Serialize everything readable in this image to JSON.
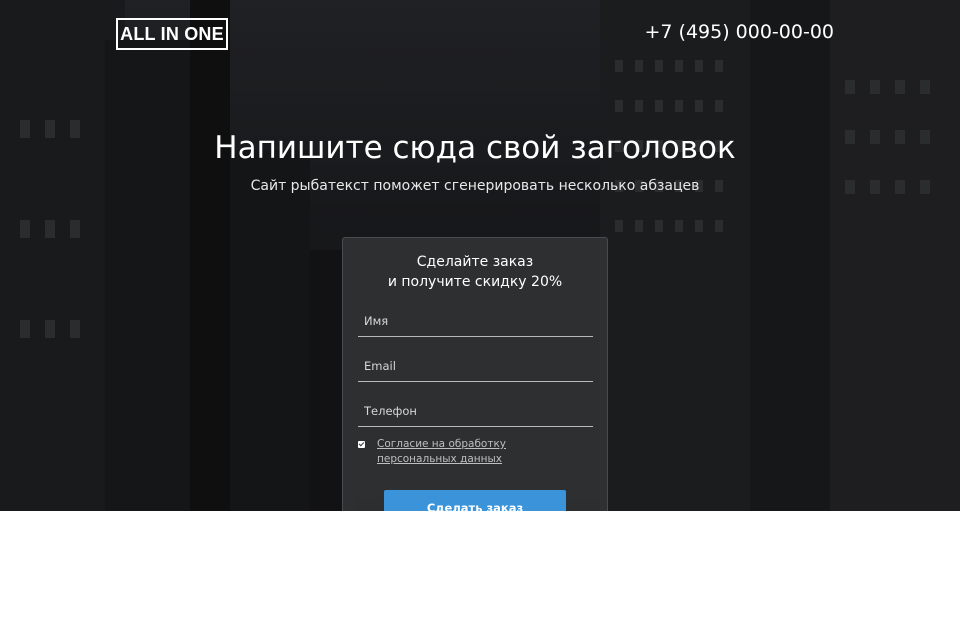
{
  "header": {
    "logo_text": "ALL IN ONE",
    "phone": "+7 (495) 000-00-00"
  },
  "hero": {
    "title": "Напишите сюда свой заголовок",
    "subtitle": "Сайт рыбатекст поможет сгенерировать несколько абзацев"
  },
  "form": {
    "title_line1": "Сделайте заказ",
    "title_line2": "и получите скидку 20%",
    "name_placeholder": "Имя",
    "email_placeholder": "Email",
    "phone_placeholder": "Телефон",
    "consent_text": "Согласие на обработку персональных данных",
    "consent_checked": true,
    "submit_label": "Сделать заказ"
  },
  "colors": {
    "accent": "#3b94d9",
    "card": "#303133",
    "text": "#ffffff"
  }
}
